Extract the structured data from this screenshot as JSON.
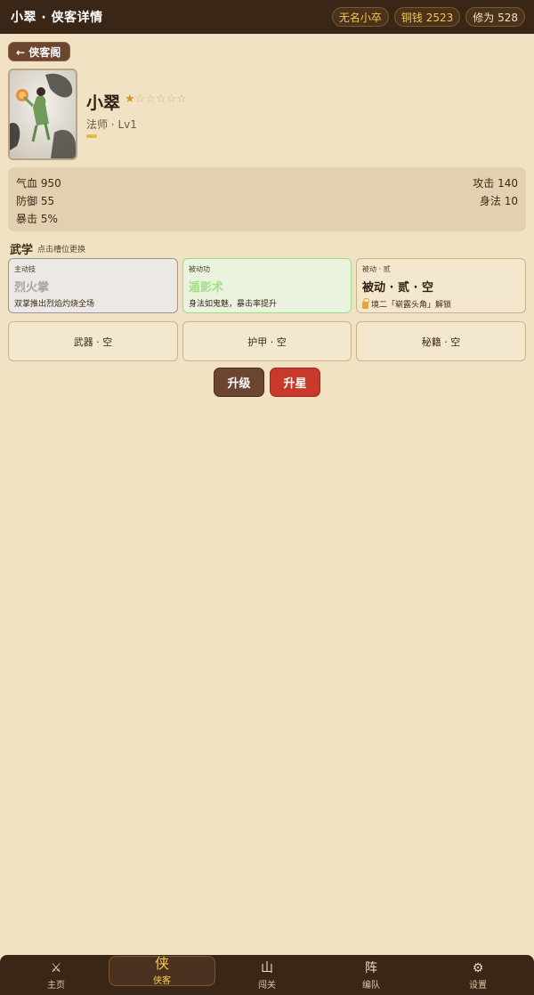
{
  "header": {
    "title": "小翠 · 侠客详情",
    "rank": "无名小卒",
    "coins": "铜钱 2523",
    "cultivation": "修为 528"
  },
  "back_label": "← 侠客阁",
  "hero": {
    "name": "小翠",
    "stars_filled": "★",
    "stars_empty": "☆☆☆☆☆",
    "star_count": 1,
    "class_level": "法师 · Lv1",
    "exp_progress": 0.03
  },
  "stats": {
    "hp": "气血 950",
    "attack": "攻击 140",
    "defense": "防御 55",
    "agility": "身法 10",
    "crit": "暴击 5%"
  },
  "skills": {
    "title": "武学",
    "hint": "点击槽位更换",
    "slots": [
      {
        "kind": "主动技",
        "name": "烈火掌",
        "desc": "双掌推出烈焰灼烧全场"
      },
      {
        "kind": "被动功",
        "name": "遁影术",
        "desc": "身法如鬼魅，暴击率提升"
      },
      {
        "kind": "被动 · 贰",
        "name": "被动 · 贰 · 空",
        "desc": "境二「崭露头角」解锁"
      }
    ]
  },
  "equipment": [
    {
      "label": "武器 · 空"
    },
    {
      "label": "护甲 · 空"
    },
    {
      "label": "秘籍 · 空"
    }
  ],
  "actions": {
    "upgrade": "升级",
    "star_up": "升星"
  },
  "nav": [
    {
      "icon": "⚔",
      "label": "主页",
      "icon_name": "crossed-swords-icon"
    },
    {
      "icon": "侠",
      "label": "侠客",
      "icon_name": "hero-glyph-icon"
    },
    {
      "icon": "山",
      "label": "闯关",
      "icon_name": "mountain-glyph-icon"
    },
    {
      "icon": "阵",
      "label": "编队",
      "icon_name": "formation-glyph-icon"
    },
    {
      "icon": "⚙",
      "label": "设置",
      "icon_name": "gear-icon"
    }
  ],
  "colors": {
    "background": "#f0e2c2",
    "header_bg": "#3a2616",
    "accent_gold": "#f3c94a",
    "star_button": "#c8392b",
    "upgrade_button": "#6b4530"
  }
}
